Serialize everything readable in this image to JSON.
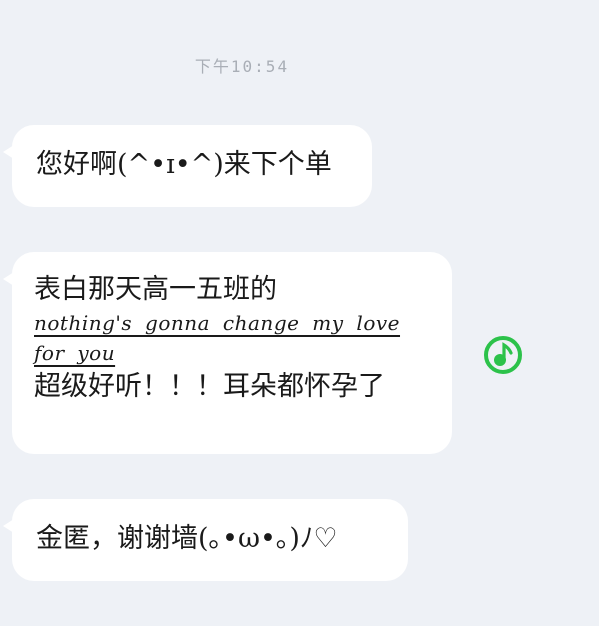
{
  "chat": {
    "timestamp": "下午10:54",
    "messages": [
      {
        "text": "您好啊(^•ɪ•^)来下个单"
      },
      {
        "line1": "表白那天高一五班的",
        "song": "nothing's gonna change my love for you",
        "line2": "超级好听！！！耳朵都怀孕了"
      },
      {
        "text": "金匿，谢谢墙(｡•ω•｡)ﾉ♡"
      }
    ],
    "music_icon": "music-note-icon",
    "colors": {
      "background": "#eef1f6",
      "bubble": "#ffffff",
      "timestamp": "#a9aeb6",
      "music_icon": "#2cc24a"
    }
  }
}
